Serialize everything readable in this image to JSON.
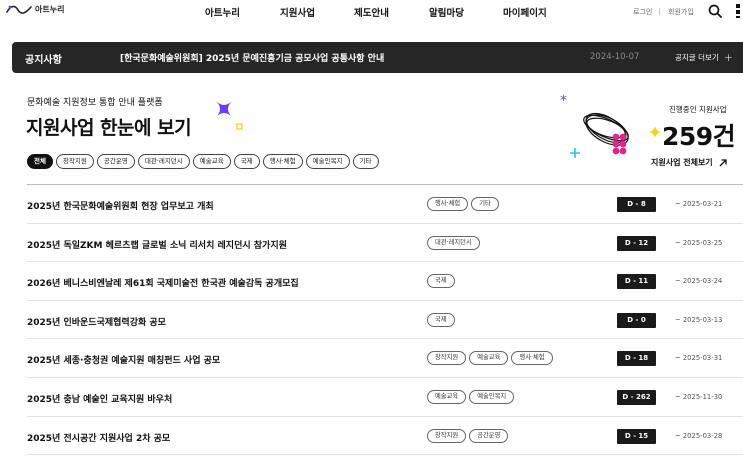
{
  "header": {
    "logo_text": "아트누리",
    "menu": [
      "아트누리",
      "지원사업",
      "제도안내",
      "알림마당",
      "마이페이지"
    ],
    "login": "로그인",
    "signup": "회원가입"
  },
  "notice": {
    "title": "공지사항",
    "text": "[한국문화예술위원회] 2025년 문예진흥기금 공모사업 공통사항 안내",
    "date": "2024-10-07",
    "more": "공지글 더보기"
  },
  "hero": {
    "subtitle": "문화예술 지원정보 통합 안내 플랫폼",
    "title": "지원사업 한눈에 보기"
  },
  "categories": [
    "전체",
    "창작지원",
    "공간운영",
    "대관·레지던시",
    "예술교육",
    "국제",
    "행사·체험",
    "예술인복지",
    "기타"
  ],
  "stats": {
    "label": "진행중인 지원사업",
    "count": "259건",
    "link": "지원사업 전체보기"
  },
  "programs": [
    {
      "title": "2025년 한국문화예술위원회 현장 업무보고 개최",
      "tags": [
        "행사·체험",
        "기타"
      ],
      "dday": "D - 8",
      "end": "~ 2025-03-21"
    },
    {
      "title": "2025년 독일ZKM 헤르츠랩 글로벌 소닉 리서치 레지던시 참가지원",
      "tags": [
        "대관·레지던시"
      ],
      "dday": "D - 12",
      "end": "~ 2025-03-25"
    },
    {
      "title": "2026년 베니스비엔날레 제61회 국제미술전 한국관 예술감독 공개모집",
      "tags": [
        "국제"
      ],
      "dday": "D - 11",
      "end": "~ 2025-03-24"
    },
    {
      "title": "2025년 인바운드국제협력강화 공모",
      "tags": [
        "국제"
      ],
      "dday": "D - 0",
      "end": "~ 2025-03-13"
    },
    {
      "title": "2025년 세종·충청권 예술지원 매칭펀드 사업 공모",
      "tags": [
        "창작지원",
        "예술교육",
        "행사·체험"
      ],
      "dday": "D - 18",
      "end": "~ 2025-03-31"
    },
    {
      "title": "2025년 충남 예술인 교육지원 바우처",
      "tags": [
        "예술교육",
        "예술인복지"
      ],
      "dday": "D - 262",
      "end": "~ 2025-11-30"
    },
    {
      "title": "2025년 전시공간 지원사업 2차 공모",
      "tags": [
        "창작지원",
        "공간운영"
      ],
      "dday": "D - 15",
      "end": "~ 2025-03-28"
    }
  ],
  "colors": {
    "accent_purple": "#6b3df5",
    "accent_pink": "#e0258c",
    "accent_yellow": "#f2d21a",
    "accent_teal": "#2ec4d6",
    "notice_bg": "#262626"
  },
  "icons": [
    "logo-icon",
    "search-icon",
    "more-menu-icon",
    "plus-icon",
    "arrow-up-right-icon"
  ]
}
